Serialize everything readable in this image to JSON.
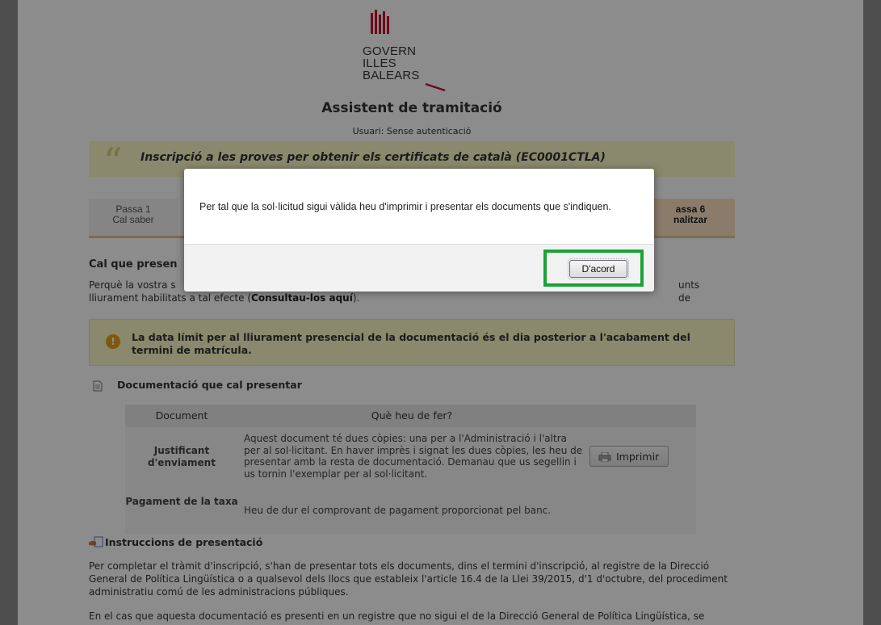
{
  "header": {
    "org_lines": [
      "GOVERN",
      "ILLES",
      "BALEARS"
    ],
    "app_title": "Assistent de tramitació",
    "user_line": "Usuari: Sense autenticació"
  },
  "procedure": {
    "title": "Inscripció a les proves per obtenir els certificats de català (EC0001CTLA)"
  },
  "steps": {
    "first": {
      "label": "Passa 1",
      "sub": "Cal saber"
    },
    "last": {
      "label": "assa 6",
      "sub": "nalitzar"
    }
  },
  "main": {
    "heading": "Cal que presen",
    "intro_line1": "Perquè la vostra s",
    "intro_line1_end": "unts de",
    "intro_line2_prefix": "lliurament habilitats a tal efecte (",
    "intro_link": "Consultau-los aquí",
    "intro_line2_suffix": ")."
  },
  "warning": {
    "icon": "exclamation-icon",
    "text": "La data límit per al lliurament presencial de la documentació és el dia posterior a l'acabament del termini de matrícula."
  },
  "documents": {
    "heading": "Documentació que cal presentar",
    "columns": [
      "Document",
      "Què heu de fer?",
      ""
    ],
    "rows": [
      {
        "name": "Justificant d'enviament",
        "description": "Aquest document té dues còpies: una per a l'Administració i l'altra per al sol·licitant. En haver imprès i signat les dues còpies, les heu de presentar amb la resta de documentació. Demanau que us segellin i us tornin l'exemplar per al sol·licitant.",
        "action": "Imprimir"
      },
      {
        "name": "Pagament de la taxa",
        "description": "Heu de dur el comprovant de pagament proporcionat pel banc."
      }
    ]
  },
  "instructions": {
    "heading": "Instruccions de presentació",
    "para1": "Per completar el tràmit d'inscripció, s'han de presentar tots els documents, dins el termini d'inscripció, al registre de la Direcció General de Política Lingüística o a qualsevol dels llocs que estableix l'article 16.4 de la Llei 39/2015, d'1 d'octubre, del procediment administratiu comú de les administracions públiques.",
    "para2": "En el cas que aquesta documentació es presenti en un registre que no sigui el de la Direcció General de Política Lingüística, se"
  },
  "modal": {
    "message": "Per tal que la sol·licitud sigui vàlida heu d'imprimir i presentar els documents que s'indiquen.",
    "ok_label": "D'acord"
  },
  "colors": {
    "overlay": "rgba(0,0,0,0.45)",
    "highlight": "#1aa235",
    "banner": "#fbf7c6",
    "brand_red": "#c8102e"
  }
}
